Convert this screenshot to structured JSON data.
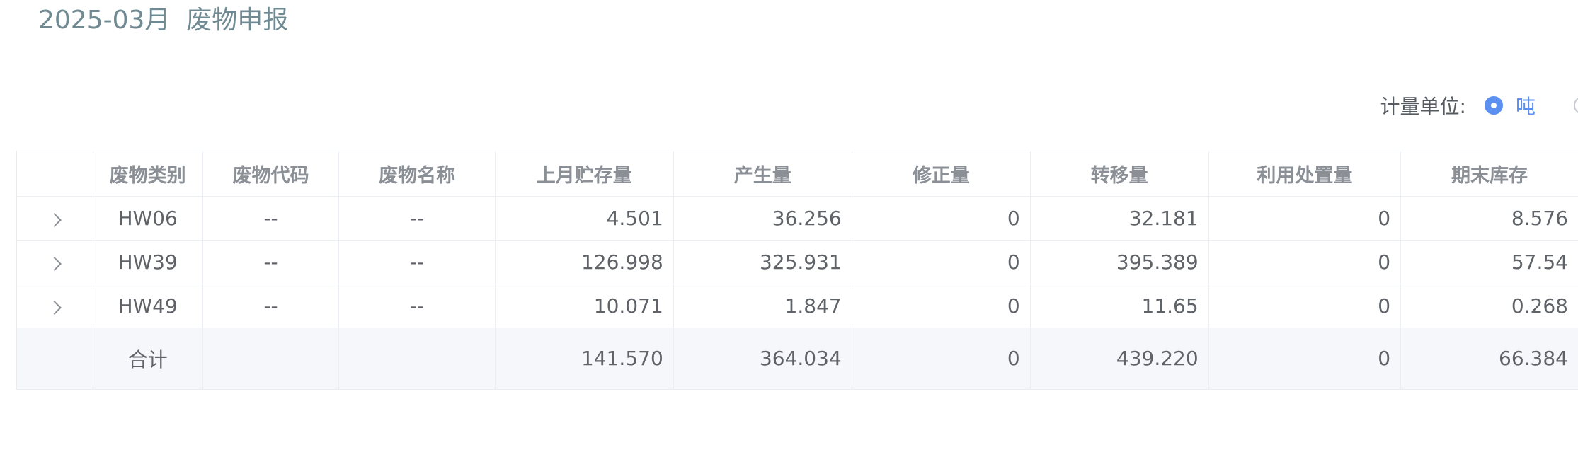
{
  "header": {
    "title": "2025-03月  废物申报"
  },
  "unit": {
    "label": "计量单位:",
    "selected_label": "吨"
  },
  "table": {
    "columns": [
      "",
      "废物类别",
      "废物代码",
      "废物名称",
      "上月贮存量",
      "产生量",
      "修正量",
      "转移量",
      "利用处置量",
      "期末库存"
    ],
    "rows": [
      {
        "category": "HW06",
        "code": "--",
        "name": "--",
        "last_month": "4.501",
        "produced": "36.256",
        "corrected": "0",
        "transferred": "32.181",
        "disposed": "0",
        "ending": "8.576"
      },
      {
        "category": "HW39",
        "code": "--",
        "name": "--",
        "last_month": "126.998",
        "produced": "325.931",
        "corrected": "0",
        "transferred": "395.389",
        "disposed": "0",
        "ending": "57.54"
      },
      {
        "category": "HW49",
        "code": "--",
        "name": "--",
        "last_month": "10.071",
        "produced": "1.847",
        "corrected": "0",
        "transferred": "11.65",
        "disposed": "0",
        "ending": "0.268"
      }
    ],
    "total": {
      "label": "合计",
      "last_month": "141.570",
      "produced": "364.034",
      "corrected": "0",
      "transferred": "439.220",
      "disposed": "0",
      "ending": "66.384"
    }
  },
  "colors": {
    "accent": "#5b8ff0",
    "title": "#6f8a92",
    "total_row_bg": "#f5f7fa"
  },
  "icons": {
    "expand": "chevron-right-icon",
    "radio_selected": "radio-checked-icon",
    "radio_unselected": "radio-unchecked-icon"
  }
}
